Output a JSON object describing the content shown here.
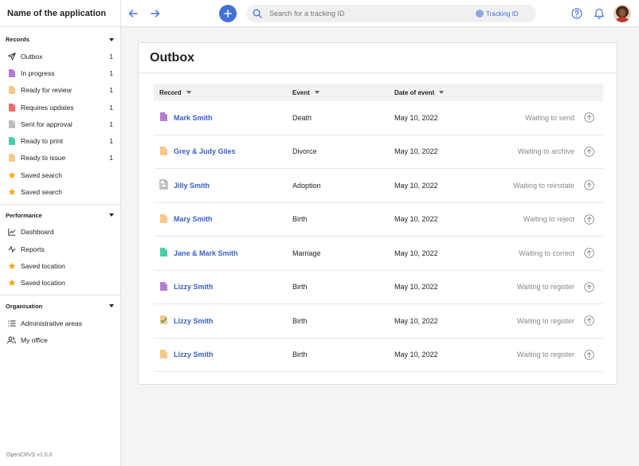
{
  "app": {
    "name": "Name of the application",
    "version": "OpenCRVS  v1.0.0"
  },
  "colors": {
    "accent": "#4272d7",
    "link": "#3a5fc6",
    "purple": "#b57bd0",
    "orange": "#f6c98a",
    "red": "#ef6b6b",
    "grey": "#bdbdbd",
    "green": "#4ccda9",
    "star": "#f1a81b"
  },
  "sidebar": {
    "sections": [
      {
        "title": "Records",
        "items": [
          {
            "label": "Outbox",
            "count": "1",
            "icon": "send-icon"
          },
          {
            "label": "In progress",
            "count": "1",
            "icon": "purple-doc-icon"
          },
          {
            "label": "Ready for review",
            "count": "1",
            "icon": "orange-doc-icon"
          },
          {
            "label": "Requires updates",
            "count": "1",
            "icon": "red-doc-icon"
          },
          {
            "label": "Sent for approval",
            "count": "1",
            "icon": "grey-doc-icon"
          },
          {
            "label": "Ready to print",
            "count": "1",
            "icon": "green-doc-icon"
          },
          {
            "label": "Ready to issue",
            "count": "1",
            "icon": "orange-doc-icon"
          },
          {
            "label": "Saved search",
            "count": "",
            "icon": "star-icon"
          },
          {
            "label": "Saved search",
            "count": "",
            "icon": "star-icon"
          }
        ]
      },
      {
        "title": "Performance",
        "items": [
          {
            "label": "Dashboard",
            "icon": "chart-icon"
          },
          {
            "label": "Reports",
            "icon": "activity-icon"
          },
          {
            "label": "Saved location",
            "icon": "star-icon"
          },
          {
            "label": "Saved location",
            "icon": "star-icon"
          }
        ]
      },
      {
        "title": "Organisation",
        "items": [
          {
            "label": "Administrative areas",
            "icon": "list-icon"
          },
          {
            "label": "My office",
            "icon": "users-icon"
          }
        ]
      }
    ]
  },
  "topbar": {
    "search_placeholder": "Search for a tracking ID",
    "tracking_label": "Tracking ID"
  },
  "main": {
    "title": "Outbox",
    "columns": {
      "record": "Record",
      "event": "Event",
      "date": "Date of event"
    },
    "rows": [
      {
        "name": "Mark Smith",
        "event": "Death",
        "date": "May 10, 2022",
        "status": "Waiting to send",
        "doc": "purple"
      },
      {
        "name": "Grey & Judy Giles",
        "event": "Divorce",
        "date": "May 10, 2022",
        "status": "Waiting to archive",
        "doc": "orange"
      },
      {
        "name": "Jilly Smith",
        "event": "Adoption",
        "date": "May 10, 2022",
        "status": "Waiting to reinstate",
        "doc": "grey"
      },
      {
        "name": "Mary Smith",
        "event": "Birth",
        "date": "May 10, 2022",
        "status": "Waiting to reject",
        "doc": "orange"
      },
      {
        "name": "Jane & Mark Smith",
        "event": "Marriage",
        "date": "May 10, 2022",
        "status": "Waiting to correct",
        "doc": "green"
      },
      {
        "name": "Lizzy Smith",
        "event": "Birth",
        "date": "May 10, 2022",
        "status": "Waiting to register",
        "doc": "purple"
      },
      {
        "name": "Lizzy Smith",
        "event": "Birth",
        "date": "May 10, 2022",
        "status": "Waiting to register",
        "doc": "orange-check"
      },
      {
        "name": "Lizzy Smith",
        "event": "Birth",
        "date": "May 10, 2022",
        "status": "Waiting to register",
        "doc": "orange"
      }
    ]
  }
}
